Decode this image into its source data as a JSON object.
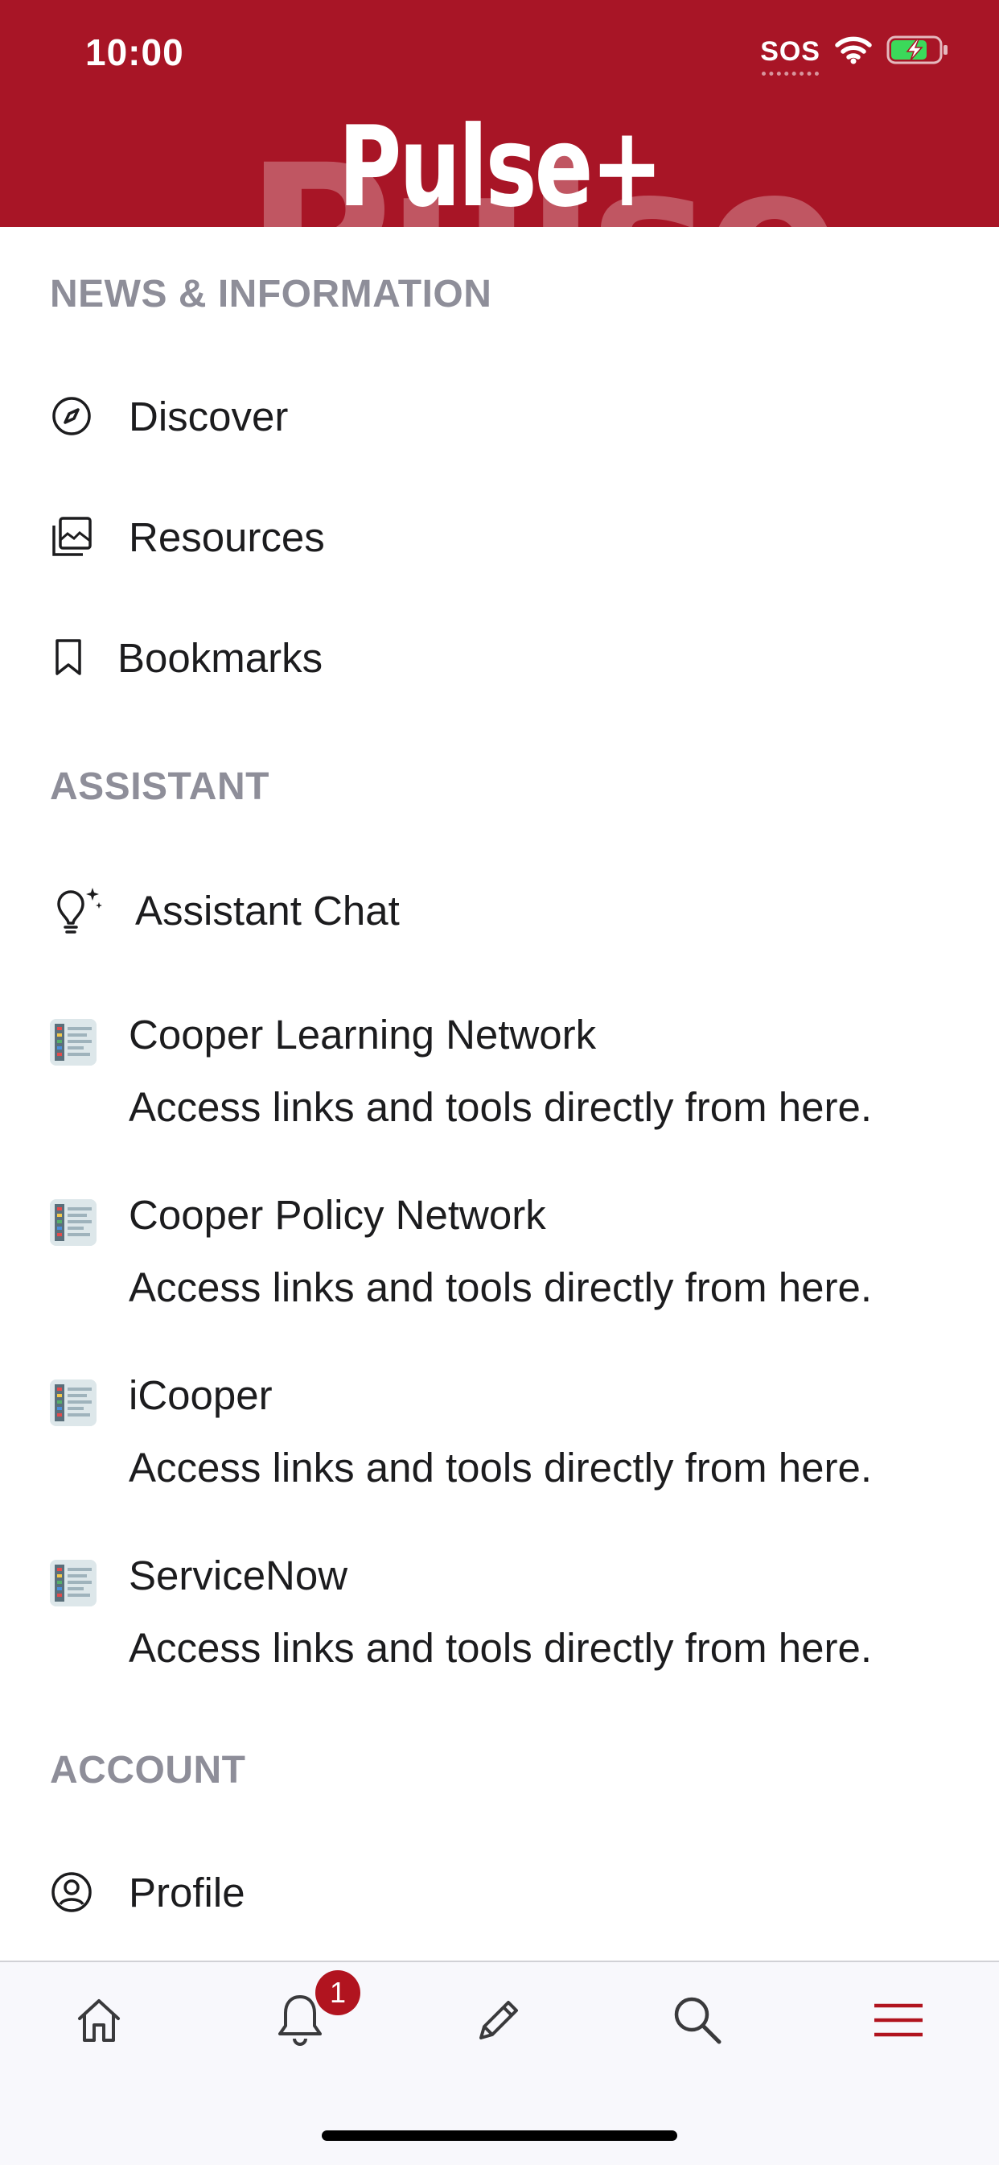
{
  "status_bar": {
    "time": "10:00",
    "sos": "SOS"
  },
  "header": {
    "logo": "Pulse+",
    "logo_ghost": "Pulse",
    "background": "#a81526"
  },
  "sections": {
    "news": {
      "title": "NEWS & INFORMATION",
      "items": [
        {
          "label": "Discover",
          "icon": "compass-icon"
        },
        {
          "label": "Resources",
          "icon": "photo-stack-icon"
        },
        {
          "label": "Bookmarks",
          "icon": "bookmark-icon"
        }
      ]
    },
    "assistant": {
      "title": "ASSISTANT",
      "items": [
        {
          "label": "Assistant Chat",
          "icon": "lightbulb-sparkle-icon"
        }
      ],
      "apps": [
        {
          "title": "Cooper Learning Network",
          "desc": "Access links and tools directly from here."
        },
        {
          "title": "Cooper Policy Network",
          "desc": "Access links and tools directly from here."
        },
        {
          "title": "iCooper",
          "desc": "Access links and tools directly from here."
        },
        {
          "title": "ServiceNow",
          "desc": "Access links and tools directly from here."
        }
      ]
    },
    "account": {
      "title": "ACCOUNT",
      "items": [
        {
          "label": "Profile",
          "icon": "person-circle-icon"
        }
      ]
    }
  },
  "tabbar": {
    "tabs": [
      "home-icon",
      "bell-icon",
      "pencil-icon",
      "search-icon",
      "menu-icon"
    ],
    "notification_count": "1",
    "active_color": "#b1141f"
  }
}
